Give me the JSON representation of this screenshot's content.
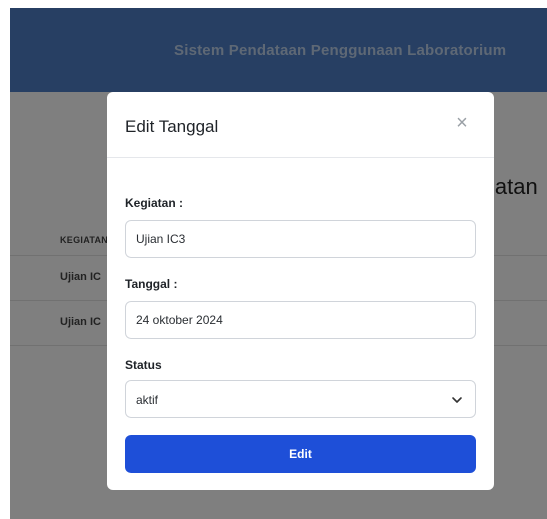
{
  "navbar": {
    "title": "Sistem Pendataan Penggunaan Laboratorium"
  },
  "page": {
    "heading_partial": "iatan",
    "table": {
      "header": "KEGIATAN",
      "rows": [
        "Ujian IC",
        "Ujian IC"
      ]
    }
  },
  "modal": {
    "title": "Edit Tanggal",
    "close_icon": "close-icon",
    "kegiatan": {
      "label": "Kegiatan :",
      "value": "Ujian IC3"
    },
    "tanggal": {
      "label": "Tanggal :",
      "value": "24 oktober 2024"
    },
    "status": {
      "label": "Status",
      "selected": "aktif",
      "icon": "chevron-down-icon"
    },
    "submit_label": "Edit"
  },
  "colors": {
    "navbar": "#4e7fc6",
    "primary_button": "#1e4fd8",
    "overlay": "rgba(0,0,0,0.5)"
  }
}
